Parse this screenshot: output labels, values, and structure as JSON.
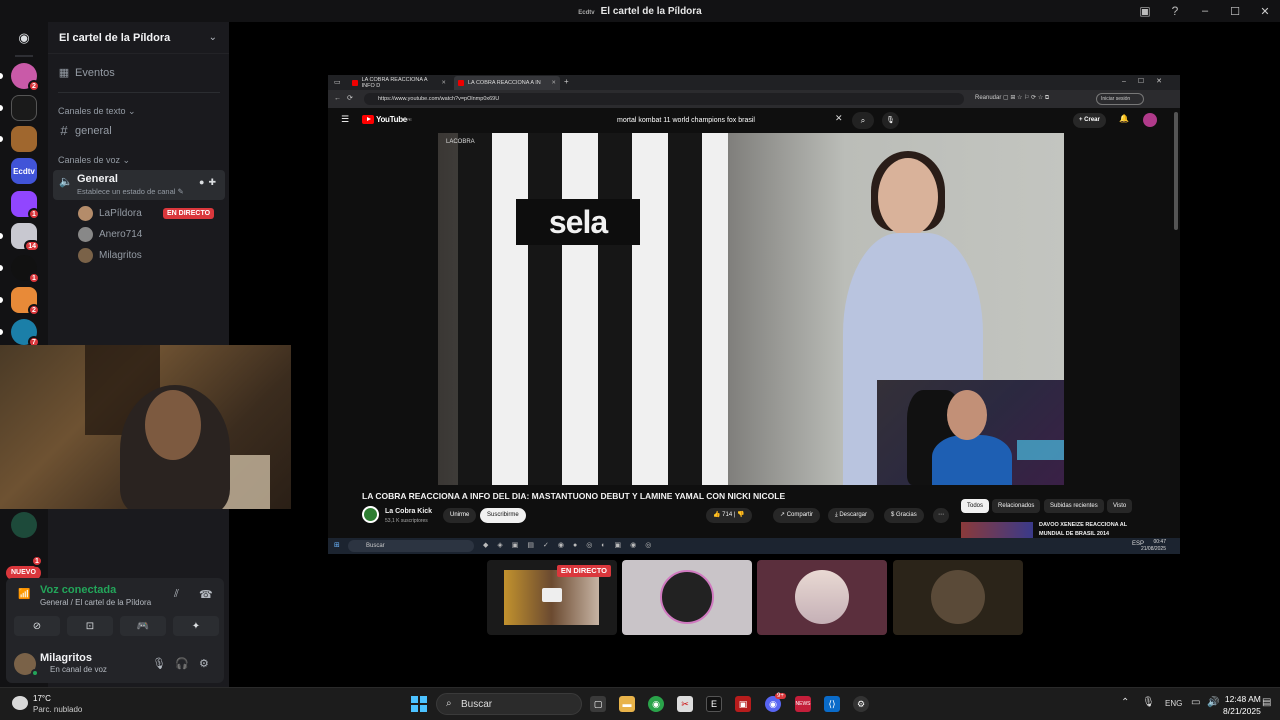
{
  "window": {
    "title": "El cartel de la Píldora"
  },
  "rail": {
    "badges": [
      "2",
      "1",
      "1",
      "14",
      "1",
      "2",
      "7",
      "1"
    ],
    "nuevo_label": "NUEVO",
    "server_labels": {
      "ecd": "Ecdtv"
    }
  },
  "sidebar": {
    "guild_name": "El cartel de la Píldora",
    "events_label": "Eventos",
    "text_category": "Canales de texto",
    "text_channel": "general",
    "voice_category": "Canales de voz",
    "voice_channel": "General",
    "voice_status": "Establece un estado de canal",
    "voice_users": [
      {
        "name": "LaPíldora",
        "live": "EN DIRECTO"
      },
      {
        "name": "Anero714"
      },
      {
        "name": "Milagritos"
      }
    ]
  },
  "voice_panel": {
    "title": "Voz conectada",
    "subtitle": "General / El cartel de la Píldora",
    "user_name": "Milagritos",
    "user_status": "En canal de voz"
  },
  "browser": {
    "tabs": [
      {
        "label": "LA COBRA REACCIONA A INFO D"
      },
      {
        "label": "LA COBRA REACCIONA A IN"
      }
    ],
    "url": "https://www.youtube.com/watch?v=pOlnmp0x69U",
    "resume_label": "Reanudar",
    "session_label": "Iniciar sesión"
  },
  "youtube": {
    "logo": "YouTube",
    "logo_suffix": "PE",
    "search_query": "mortal kombat 11 world champions fox brasil",
    "create_label": "Crear",
    "watermark": "LACOBRA",
    "shirt_text": "sela",
    "video_title": "LA COBRA REACCIONA A INFO DEL DIA: MASTANTUONO DEBUT Y LAMINE YAMAL CON NICKI NICOLE",
    "channel_name": "La Cobra Kick",
    "subscribers": "53,1 K suscriptores",
    "join_label": "Unirme",
    "subscribe_label": "Suscribirme",
    "likes": "714",
    "share_label": "Compartir",
    "download_label": "Descargar",
    "thanks_label": "Gracias",
    "chips": [
      "Todos",
      "Relacionados",
      "Subidas recientes",
      "Visto"
    ],
    "rec_title": "DAVOO XENEIZE REACCIONA AL MUNDIAL DE BRASIL 2014"
  },
  "inner_taskbar": {
    "search": "Buscar",
    "lang": "ESP",
    "time": "00:47",
    "date": "21/08/2025"
  },
  "tiles": {
    "live_label": "EN DIRECTO"
  },
  "taskbar": {
    "weather_temp": "17°C",
    "weather_desc": "Parc. nublado",
    "search": "Buscar",
    "lang": "ENG",
    "time": "12:48 AM",
    "date": "8/21/2025",
    "badge_discord": "9+",
    "badge_news": "NEWS"
  }
}
